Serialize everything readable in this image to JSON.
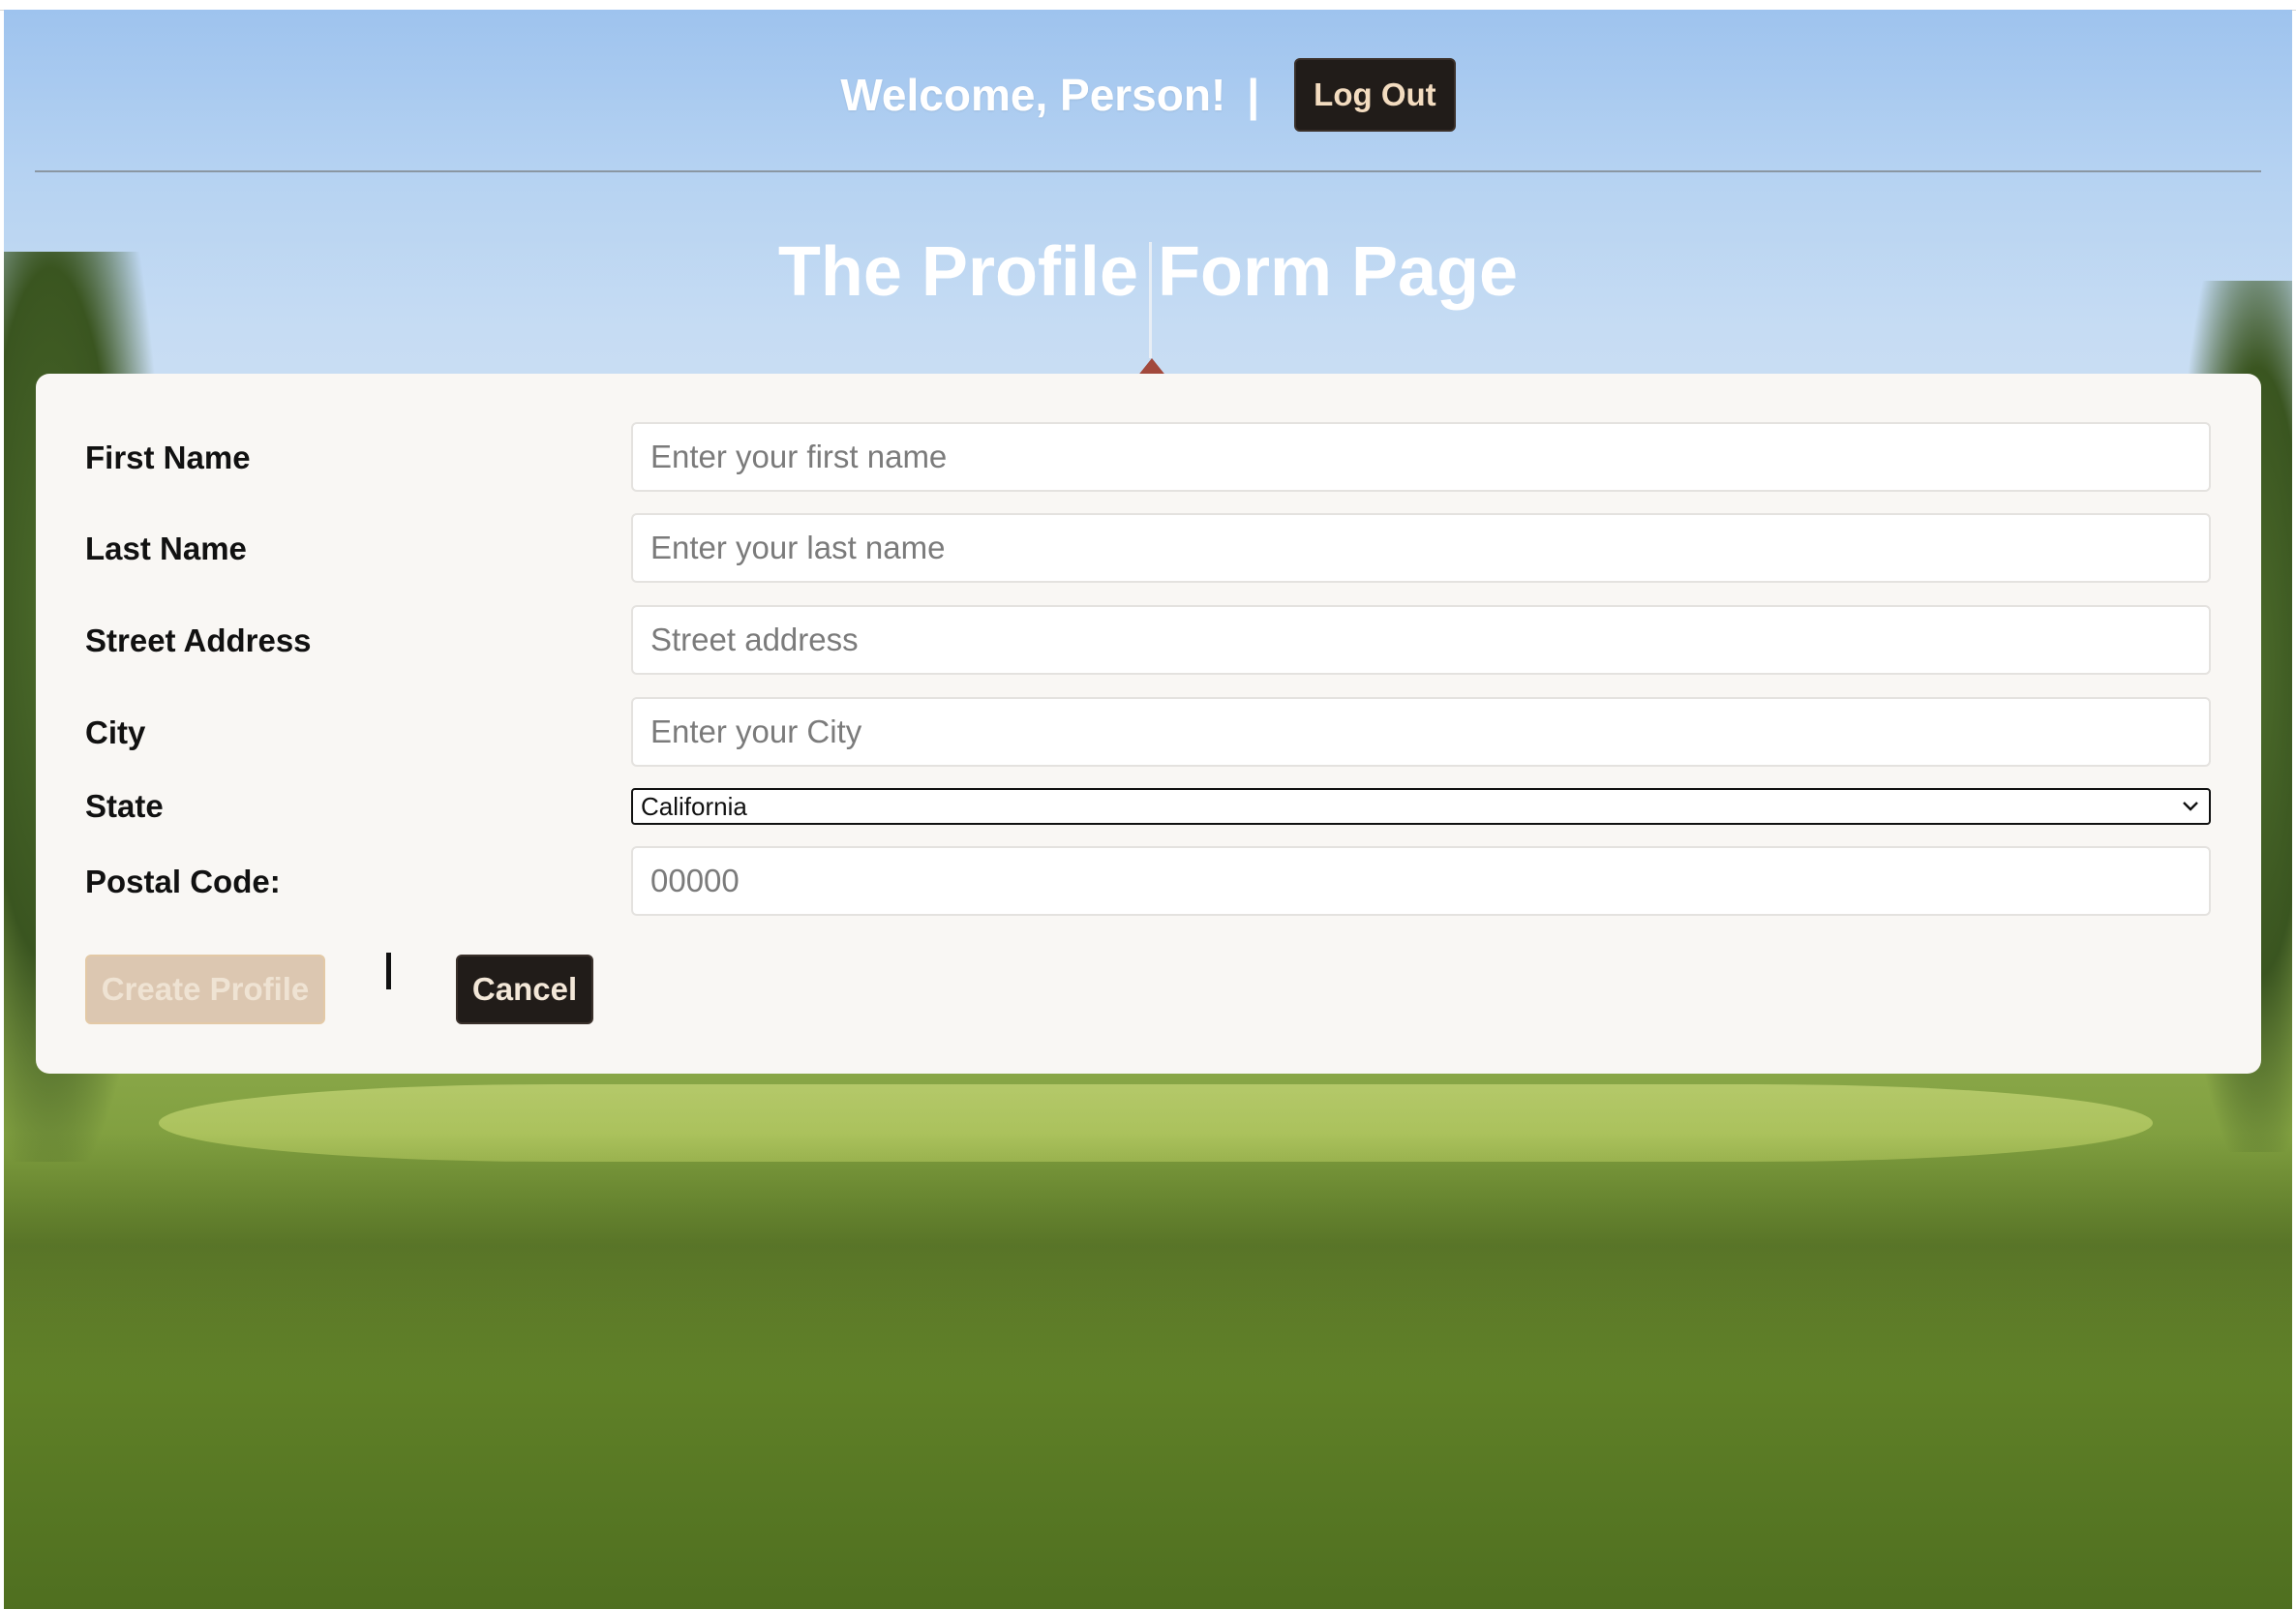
{
  "header": {
    "welcome_text": "Welcome, Person!",
    "separator": "|",
    "logout_label": "Log Out"
  },
  "page": {
    "title": "The Profile Form Page"
  },
  "form": {
    "first_name": {
      "label": "First Name",
      "placeholder": "Enter your first name",
      "value": ""
    },
    "last_name": {
      "label": "Last Name",
      "placeholder": "Enter your last name",
      "value": ""
    },
    "street_address": {
      "label": "Street Address",
      "placeholder": "Street address",
      "value": ""
    },
    "city": {
      "label": "City",
      "placeholder": "Enter your City",
      "value": ""
    },
    "state": {
      "label": "State",
      "selected": "California"
    },
    "postal_code": {
      "label": "Postal Code:",
      "placeholder": "00000",
      "value": ""
    },
    "create_label": "Create Profile",
    "separator": "|",
    "cancel_label": "Cancel"
  },
  "colors": {
    "dark_button": "#211c19",
    "dark_button_text": "#f3dcc0",
    "disabled_button": "#dcc7b1",
    "card_background": "#f9f7f4"
  },
  "icons": {
    "select_arrow": "chevron-down-icon"
  }
}
